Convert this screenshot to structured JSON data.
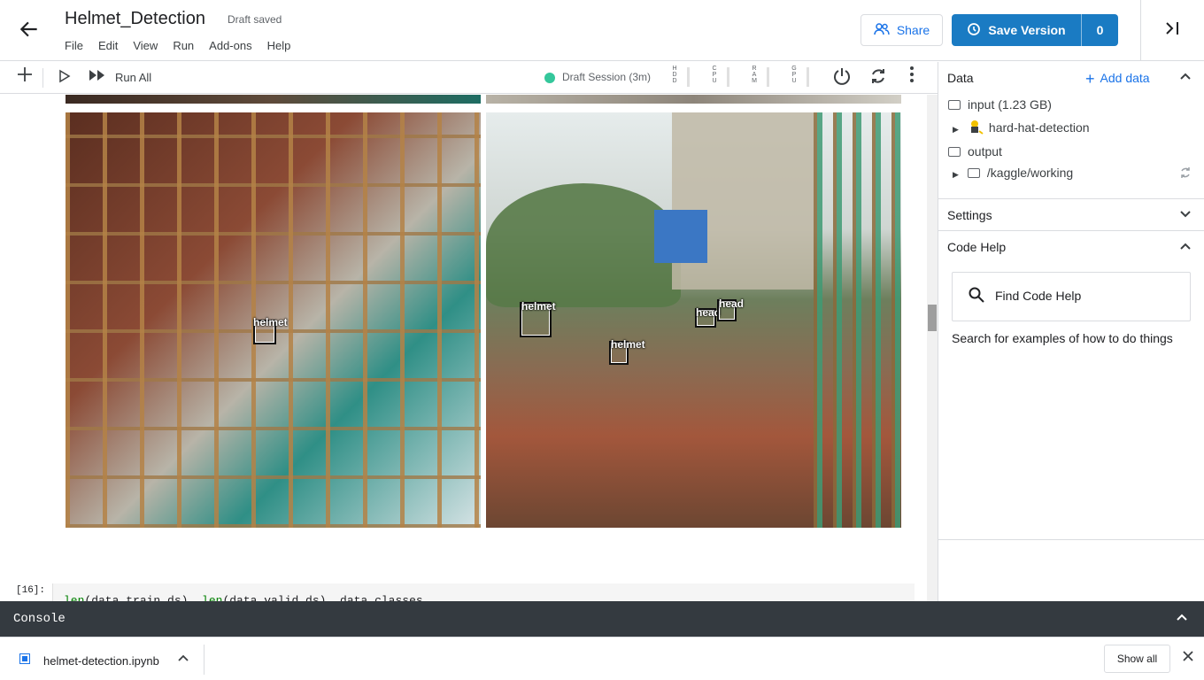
{
  "header": {
    "title": "Helmet_Detection",
    "status": "Draft saved",
    "menu": [
      "File",
      "Edit",
      "View",
      "Run",
      "Add-ons",
      "Help"
    ],
    "share_label": "Share",
    "save_label": "Save Version",
    "save_count": "0"
  },
  "toolbar": {
    "run_all_label": "Run All",
    "session_label": "Draft Session (3m)",
    "session_color": "#34c79b",
    "meters": [
      "HDD",
      "CPU",
      "RAM",
      "GPU"
    ]
  },
  "notebook": {
    "left_image_labels": [
      "helmet"
    ],
    "right_image_labels": [
      "helmet",
      "helmet",
      "head",
      "head"
    ],
    "cell_number": "[16]:",
    "code_fn1": "len",
    "code_arg1": "(data.train_ds), ",
    "code_fn2": "len",
    "code_arg2": "(data.valid_ds), data.classes"
  },
  "sidebar": {
    "data_title": "Data",
    "add_data_label": "Add data",
    "input_label": "input (1.23 GB)",
    "dataset_label": "hard-hat-detection",
    "output_label": "output",
    "working_label": "/kaggle/working",
    "settings_label": "Settings",
    "code_help_label": "Code Help",
    "find_code_help": "Find Code Help",
    "help_text": "Search for examples of how to do things"
  },
  "console": {
    "label": "Console"
  },
  "downloads": {
    "file_name": "helmet-detection.ipynb",
    "show_all_label": "Show all"
  },
  "colors": {
    "accent": "#1a7bc3",
    "link": "#1a73e8",
    "console_bg": "#343a40"
  }
}
